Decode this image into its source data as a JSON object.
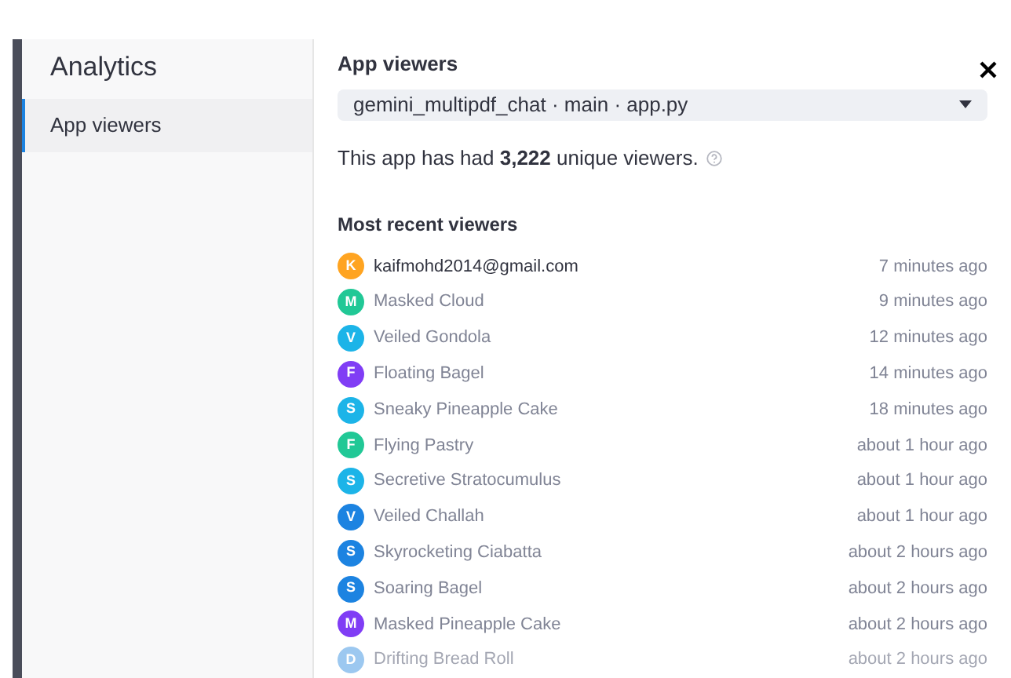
{
  "sidebar": {
    "title": "Analytics",
    "items": [
      {
        "label": "App viewers",
        "selected": true
      }
    ]
  },
  "panel": {
    "title": "App viewers",
    "app_select": {
      "value": "gemini_multipdf_chat · main · app.py"
    },
    "summary": "This app has had **3,222** unique viewers.",
    "list_title": "Most recent viewers",
    "viewers": [
      {
        "initial": "K",
        "name": "kaifmohd2014@gmail.com",
        "time": "7 minutes ago",
        "color": "#ffa421",
        "kind": "account"
      },
      {
        "initial": "M",
        "name": "Masked Cloud",
        "time": "9 minutes ago",
        "color": "#21c896",
        "kind": "guest"
      },
      {
        "initial": "V",
        "name": "Veiled Gondola",
        "time": "12 minutes ago",
        "color": "#1cb4e8",
        "kind": "guest"
      },
      {
        "initial": "F",
        "name": "Floating Bagel",
        "time": "14 minutes ago",
        "color": "#803df5",
        "kind": "guest"
      },
      {
        "initial": "S",
        "name": "Sneaky Pineapple Cake",
        "time": "18 minutes ago",
        "color": "#1cb4e8",
        "kind": "guest"
      },
      {
        "initial": "F",
        "name": "Flying Pastry",
        "time": "about 1 hour ago",
        "color": "#21c896",
        "kind": "guest"
      },
      {
        "initial": "S",
        "name": "Secretive Stratocumulus",
        "time": "about 1 hour ago",
        "color": "#1cb4e8",
        "kind": "guest"
      },
      {
        "initial": "V",
        "name": "Veiled Challah",
        "time": "about 1 hour ago",
        "color": "#1c83e1",
        "kind": "guest"
      },
      {
        "initial": "S",
        "name": "Skyrocketing Ciabatta",
        "time": "about 2 hours ago",
        "color": "#1c83e1",
        "kind": "guest"
      },
      {
        "initial": "S",
        "name": "Soaring Bagel",
        "time": "about 2 hours ago",
        "color": "#1c83e1",
        "kind": "guest"
      },
      {
        "initial": "M",
        "name": "Masked Pineapple Cake",
        "time": "about 2 hours ago",
        "color": "#803df5",
        "kind": "guest"
      },
      {
        "initial": "D",
        "name": "Drifting Bread Roll",
        "time": "about 2 hours ago",
        "color": "#9cc8f0",
        "kind": "faded"
      }
    ]
  }
}
